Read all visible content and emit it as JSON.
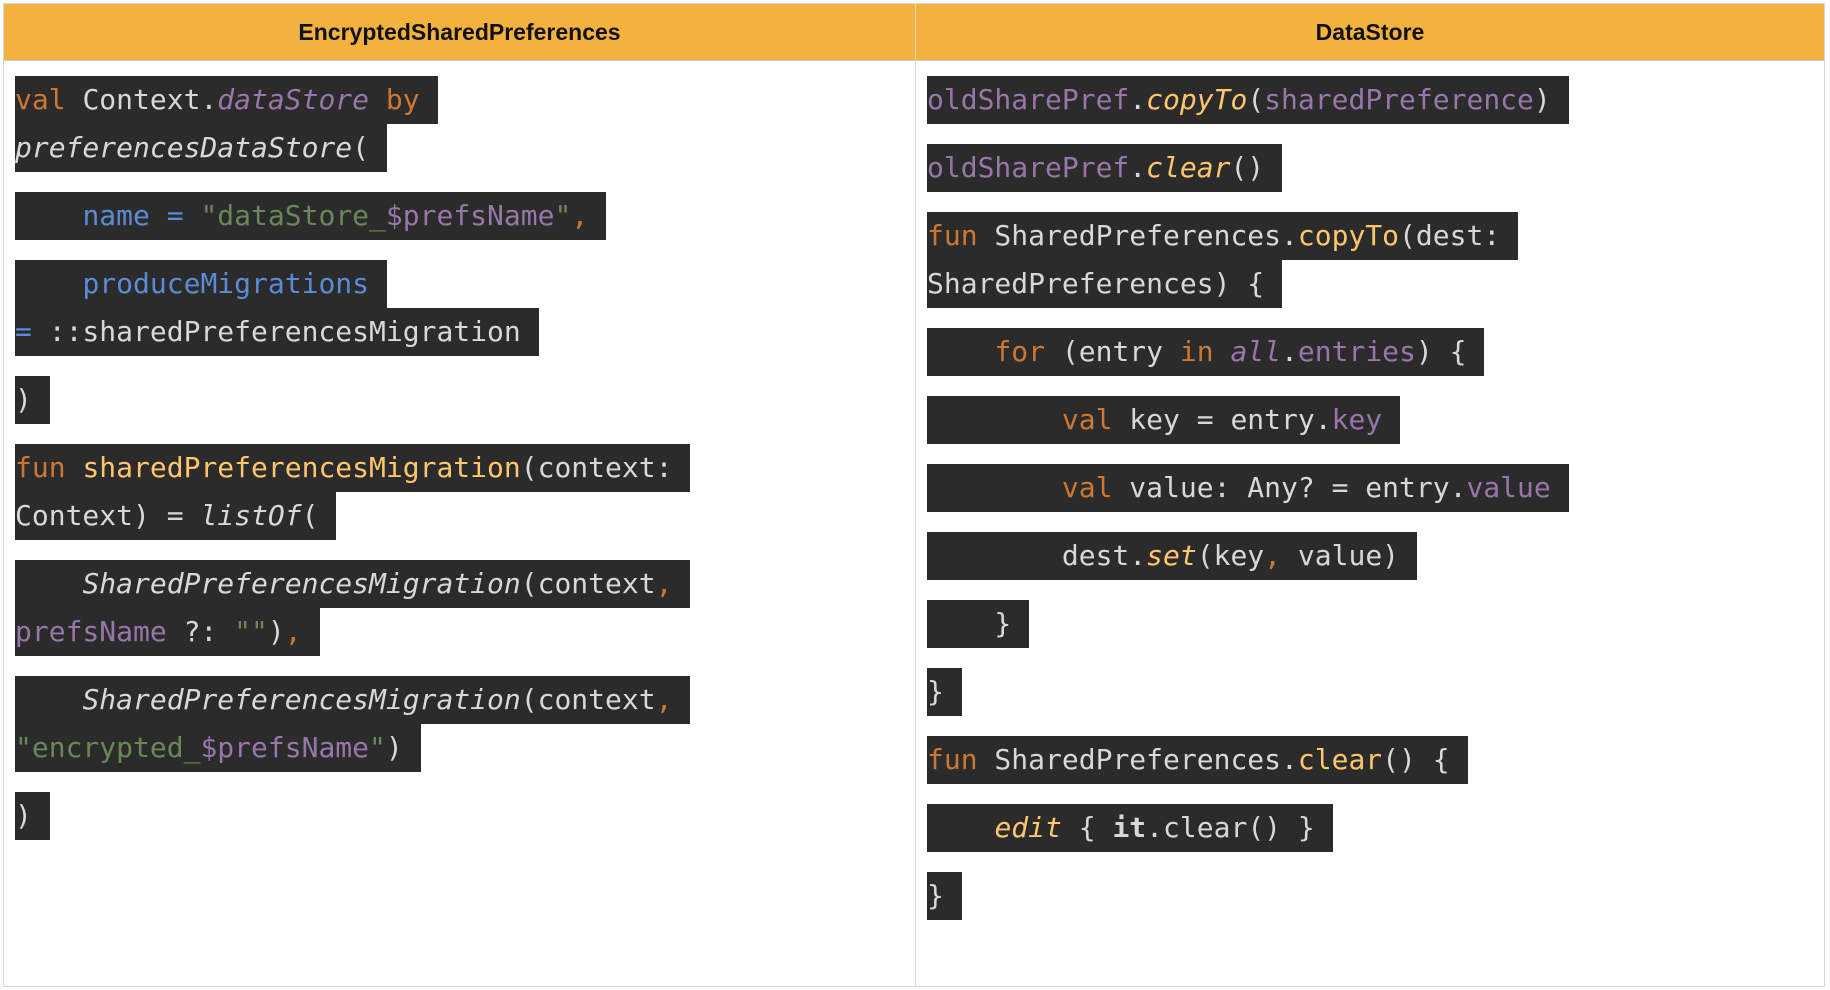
{
  "headers": {
    "left": "EncryptedSharedPreferences",
    "right": "DataStore"
  },
  "left_code": [
    "val Context.dataStore by",
    "preferencesDataStore(",
    "    name = \"dataStore_$prefsName\",",
    "    produceMigrations",
    "= ::sharedPreferencesMigration",
    ")",
    "fun sharedPreferencesMigration(context:",
    "Context) = listOf(",
    "    SharedPreferencesMigration(context,",
    "prefsName ?: \"\"),",
    "    SharedPreferencesMigration(context,",
    "\"encrypted_$prefsName\")",
    ")"
  ],
  "right_code": [
    "oldSharePref.copyTo(sharedPreference)",
    "oldSharePref.clear()",
    "fun SharedPreferences.copyTo(dest:",
    "SharedPreferences) {",
    "    for (entry in all.entries) {",
    "        val key = entry.key",
    "        val value: Any? = entry.value",
    "        dest.set(key, value)",
    "    }",
    "}",
    "fun SharedPreferences.clear() {",
    "    edit { it.clear() }",
    "}"
  ]
}
